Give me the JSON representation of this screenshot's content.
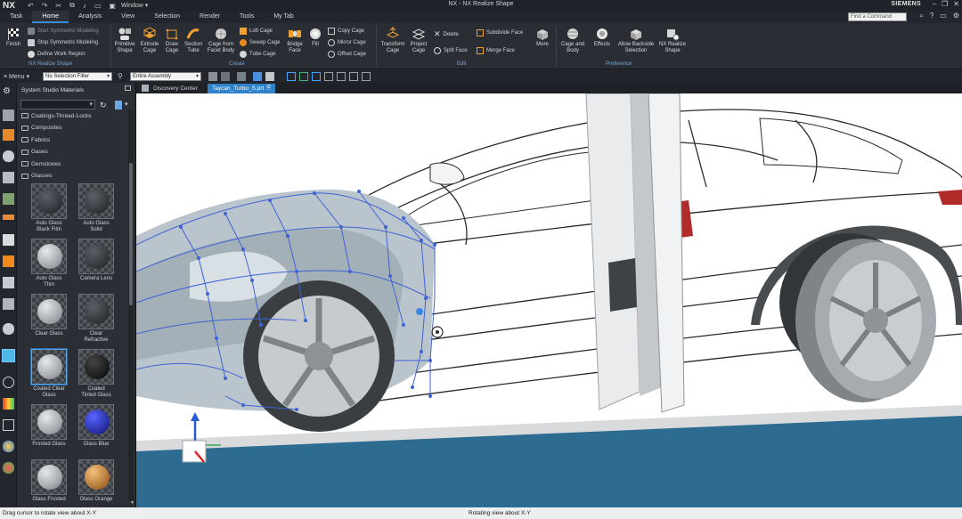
{
  "app": {
    "logo": "NX",
    "title": "NX - NX Realize Shape",
    "window_menu": "Window ▾",
    "brand": "SIEMENS"
  },
  "menu_tabs": [
    "Task",
    "Home",
    "Analysis",
    "View",
    "Selection",
    "Render",
    "Tools",
    "My Tab"
  ],
  "active_tab": "Home",
  "command_search": {
    "placeholder": "Find a Command"
  },
  "ribbon": {
    "finish": "Finish",
    "symmetric_start": "Start Symmetric Modeling",
    "symmetric_stop": "Stop Symmetric Modeling",
    "define_work_region": "Define Work Region",
    "group_realize": "NX Realize Shape",
    "primitive": "Primitive\nShape",
    "extrude": "Extrude\nCage",
    "draw": "Draw\nCage",
    "section_tube": "Section\nTube",
    "cage_from_facet": "Cage from\nFacet Body",
    "loft_cage": "Loft Cage",
    "sweep_cage": "Sweep Cage",
    "tube_cage": "Tube Cage",
    "bridge_face": "Bridge\nFace",
    "fill": "Fill",
    "copy_cage": "Copy Cage",
    "mirror_cage": "Mirror Cage",
    "offset_cage": "Offset Cage",
    "group_create": "Create",
    "transform_cage": "Transform\nCage",
    "project_cage": "Project\nCage",
    "delete": "Delete",
    "split_face": "Split Face",
    "subdivide_face": "Subdivide Face",
    "merge_face": "Merge Face",
    "more": "More",
    "group_edit": "Edit",
    "cage_and_body": "Cage and\nBody",
    "effects": "Effects",
    "allow_backside": "Allow Backside\nSelection",
    "nx_realize_shape": "NX Realize\nShape",
    "group_preference": "Preference"
  },
  "toolbar2": {
    "menu": "≡ Menu ▾",
    "selection_filter": "No Selection Filter",
    "assembly_scope": "Entire Assembly"
  },
  "panel": {
    "title": "System Studio Materials",
    "folders": [
      "Coatings-Thread-Locks",
      "Composites",
      "Fabrics",
      "Gases",
      "Gemstones",
      "Glasses"
    ],
    "materials": [
      {
        "label": "Auto Glass\nBlack Film",
        "tone": "dark"
      },
      {
        "label": "Auto Glass\nSolid",
        "tone": "dark"
      },
      {
        "label": "Auto Glass\nThin",
        "tone": "light"
      },
      {
        "label": "Camera Lens",
        "tone": "dark"
      },
      {
        "label": "Clear Glass",
        "tone": "light"
      },
      {
        "label": "Clear\nRefractive",
        "tone": "dark"
      },
      {
        "label": "Coated Clear\nGlass",
        "tone": "light"
      },
      {
        "label": "Coated\nTinted Glass",
        "tone": "black"
      },
      {
        "label": "Frosted Glass",
        "tone": "light"
      },
      {
        "label": "Glass Blue",
        "tone": "blue"
      },
      {
        "label": "Glass Frosted",
        "tone": "light"
      },
      {
        "label": "Glass Orange",
        "tone": "orange"
      }
    ],
    "selected_index": 6
  },
  "doc_tabs": [
    {
      "label": "Discovery Center"
    },
    {
      "label": "Taycan_Turbo_S.prt"
    }
  ],
  "active_doc_tab": 1,
  "status": {
    "left": "Drag cursor to rotate view about X-Y",
    "center": "Rotating view about X-Y"
  },
  "colors": {
    "accent": "#2f82c9",
    "cage": "#3f63d6",
    "ribbon_bg": "#2a2e34"
  },
  "icons": {
    "finish": "checkered-flag-icon",
    "search": "search-icon",
    "help": "help-icon",
    "gear": "gear-icon"
  }
}
